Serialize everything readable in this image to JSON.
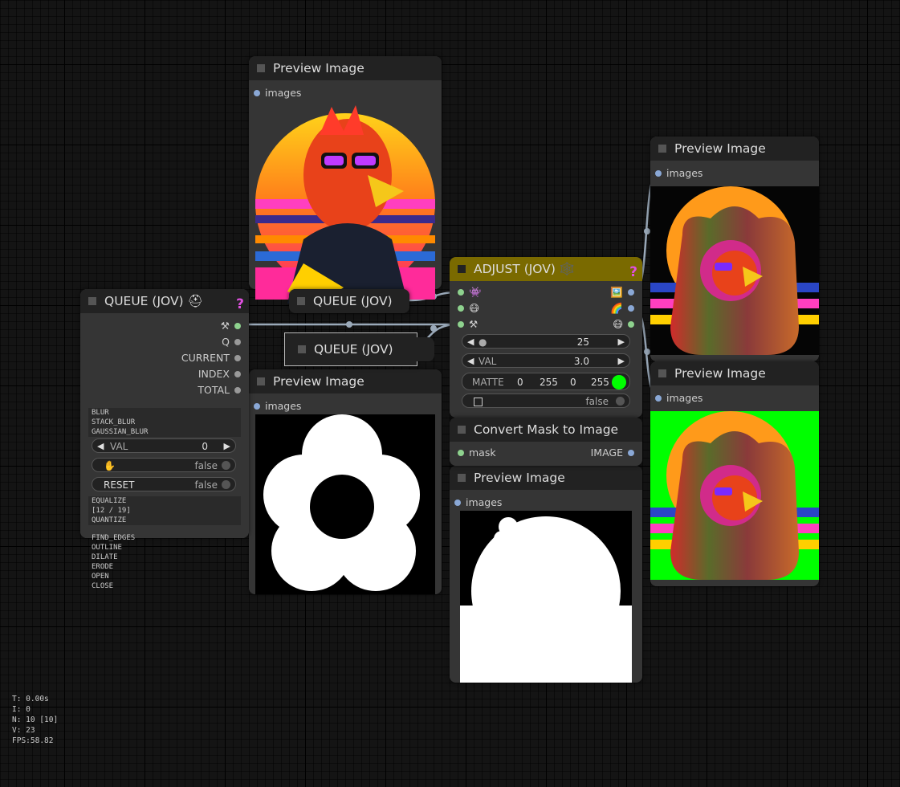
{
  "preview_top": {
    "title": "Preview Image",
    "input": "images"
  },
  "preview_right_top": {
    "title": "Preview Image",
    "input": "images"
  },
  "preview_right_bottom": {
    "title": "Preview Image",
    "input": "images"
  },
  "preview_mid": {
    "title": "Preview Image",
    "input": "images"
  },
  "preview_bottom": {
    "title": "Preview Image",
    "input": "images"
  },
  "queue_main": {
    "title": "QUEUE (JOV) ⛑",
    "help": "?",
    "out_icon": "⚒",
    "outputs": [
      "Q",
      "CURRENT",
      "INDEX",
      "TOTAL"
    ],
    "ops": [
      "BLUR",
      "STACK_BLUR",
      "GAUSSIAN_BLUR"
    ],
    "val_label": "VAL",
    "val_value": "0",
    "hand_value": "false",
    "reset_label": "RESET",
    "reset_value": "false",
    "ops2": [
      "EQUALIZE",
      "[12 / 19]",
      "QUANTIZE"
    ],
    "ops3": [
      "FIND_EDGES",
      "OUTLINE",
      "DILATE",
      "ERODE",
      "OPEN",
      "CLOSE"
    ]
  },
  "queue_collapsed_1": {
    "title": "QUEUE (JOV)"
  },
  "queue_collapsed_2": {
    "title": "QUEUE (JOV)"
  },
  "adjust": {
    "title": "ADJUST (JOV) 🕸️",
    "help": "?",
    "in_icons": [
      "👾",
      "😷",
      "⚒"
    ],
    "out_icons": [
      "🖼️",
      "🌈",
      "😷"
    ],
    "radius_value": "25",
    "val_label": "VAL",
    "val_value": "3.0",
    "matte_label": "MATTE",
    "matte_values": [
      "0",
      "255",
      "0",
      "255"
    ],
    "matte_color": "#00ff00",
    "invert_value": "false"
  },
  "convert_mask": {
    "title": "Convert Mask to Image",
    "input": "mask",
    "output": "IMAGE"
  },
  "stats": [
    "T: 0.00s",
    "I: 0",
    "N: 10 [10]",
    "V: 23",
    "FPS:58.82"
  ],
  "colors": {
    "adjust_title_bg": "#7a6a00",
    "matte_green": "#00ff00"
  }
}
